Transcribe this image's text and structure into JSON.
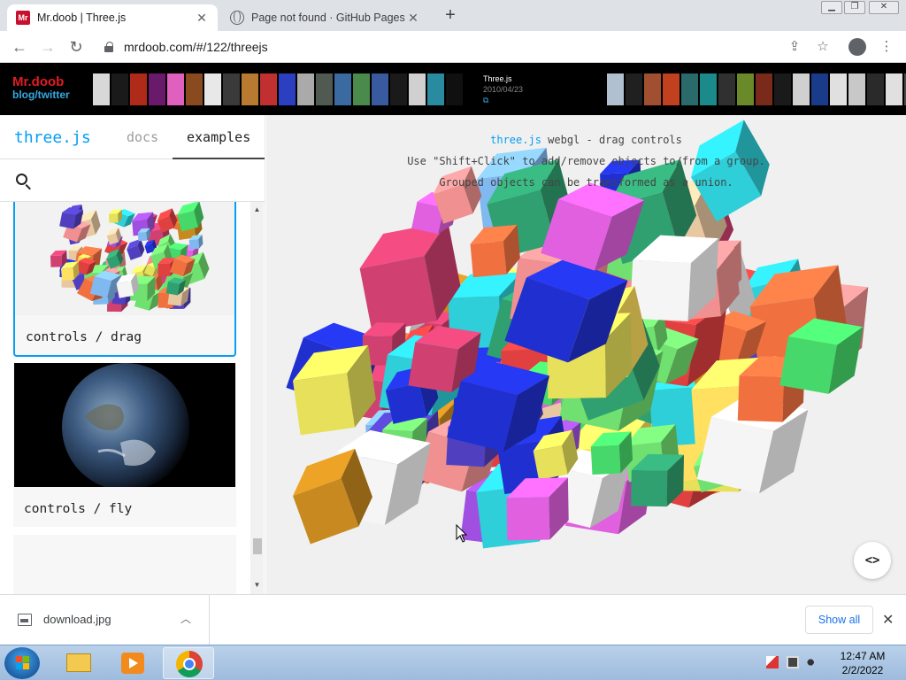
{
  "browser": {
    "tabs": [
      {
        "title": "Mr.doob | Three.js",
        "favicon": "mrdoob-favicon"
      },
      {
        "title": "Page not found · GitHub Pages",
        "favicon": "globe-icon"
      }
    ],
    "newtab_label": "+",
    "url": "mrdoob.com/#/122/threejs"
  },
  "banner": {
    "logo_line1": "Mr.doob",
    "logo_line2": "blog/twitter",
    "caption_title": "Three.js",
    "caption_date": "2010/04/23",
    "thumb_colors_left": [
      "#d8d8d8",
      "#1a1a1a",
      "#b02a1a",
      "#6a1a6a",
      "#e060c0",
      "#8a4a20",
      "#e8e8e8",
      "#3a3a3a",
      "#b87a30",
      "#c03030",
      "#2a40c0",
      "#aaaaaa",
      "#505a50",
      "#3a6aa0",
      "#4a8a4a",
      "#3a5aa0",
      "#1a1a1a",
      "#d0d0d0",
      "#2a8aa0",
      "#101010"
    ],
    "thumb_colors_right": [
      "#b0c0d0",
      "#202020",
      "#a05030",
      "#c04020",
      "#2a6a6a",
      "#1a8a8a",
      "#303030",
      "#6a8a2a",
      "#7a2a1a",
      "#1a1a1a",
      "#d0d0d0",
      "#1a3a8a",
      "#e0e0e0",
      "#c8c8c8",
      "#2a2a2a",
      "#e0e0e0",
      "#4a4a4a"
    ]
  },
  "panel": {
    "brand": "three.js",
    "tab_docs": "docs",
    "tab_examples": "examples",
    "search_placeholder": "",
    "items": [
      {
        "label": "controls / drag",
        "selected": true
      },
      {
        "label": "controls / fly",
        "selected": false
      }
    ]
  },
  "viewport": {
    "info_link": "three.js",
    "info_line1": " webgl - drag controls",
    "info_line2": "Use \"Shift+Click\" to add/remove objects to/from a group.",
    "info_line3": "Grouped objects can be transformed as a union.",
    "code_button": "<>",
    "cube_colors": [
      "#e6e05a",
      "#2ecfd8",
      "#a050e0",
      "#e060e0",
      "#f07040",
      "#46d86a",
      "#80b8f0",
      "#f5f5f5",
      "#2030d0",
      "#c88a20",
      "#e8c8a0",
      "#e04040",
      "#30a070",
      "#f09090",
      "#70e070",
      "#5040c0",
      "#d04070",
      "#ffe060"
    ]
  },
  "download": {
    "filename": "download.jpg",
    "show_all": "Show all"
  },
  "taskbar": {
    "time": "12:47 AM",
    "date": "2/2/2022"
  }
}
